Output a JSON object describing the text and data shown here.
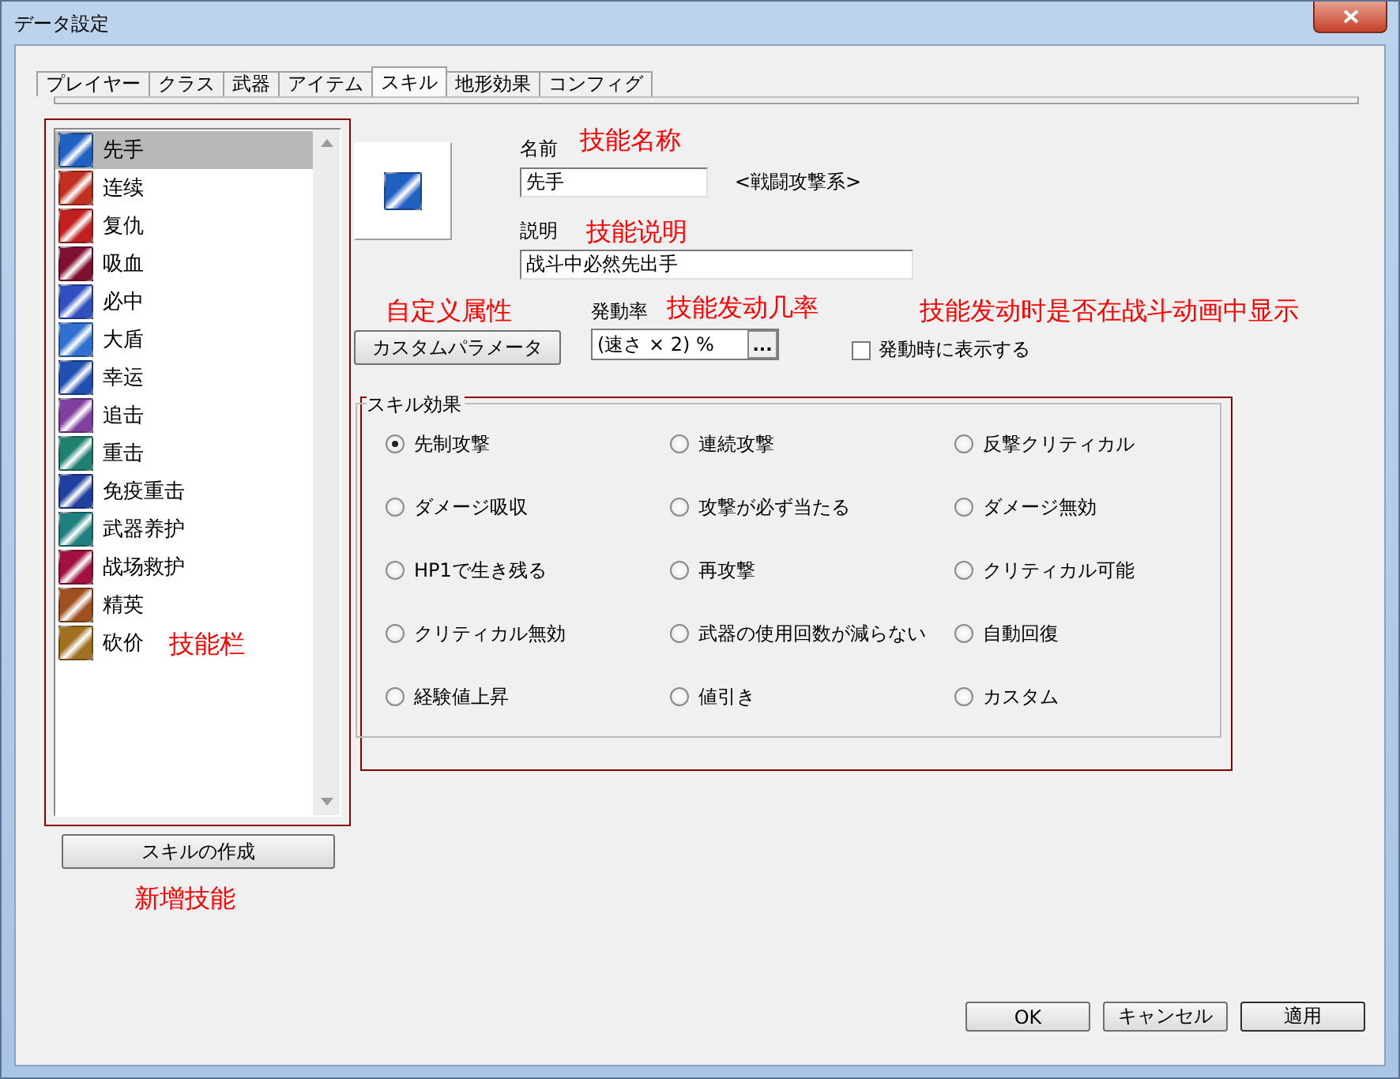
{
  "window": {
    "title": "データ設定"
  },
  "tabs": [
    {
      "label": "プレイヤー",
      "selected": false
    },
    {
      "label": "クラス",
      "selected": false
    },
    {
      "label": "武器",
      "selected": false
    },
    {
      "label": "アイテム",
      "selected": false
    },
    {
      "label": "スキル",
      "selected": true
    },
    {
      "label": "地形効果",
      "selected": false
    },
    {
      "label": "コンフィグ",
      "selected": false
    }
  ],
  "skill_list": {
    "annotation": "技能栏",
    "items": [
      {
        "label": "先手",
        "color": "#2060c0",
        "selected": true
      },
      {
        "label": "连续",
        "color": "#c03020",
        "selected": false
      },
      {
        "label": "复仇",
        "color": "#c02020",
        "selected": false
      },
      {
        "label": "吸血",
        "color": "#801030",
        "selected": false
      },
      {
        "label": "必中",
        "color": "#3050c0",
        "selected": false
      },
      {
        "label": "大盾",
        "color": "#3070d0",
        "selected": false
      },
      {
        "label": "幸运",
        "color": "#2050b0",
        "selected": false
      },
      {
        "label": "追击",
        "color": "#8040a0",
        "selected": false
      },
      {
        "label": "重击",
        "color": "#208070",
        "selected": false
      },
      {
        "label": "免疫重击",
        "color": "#2040a0",
        "selected": false
      },
      {
        "label": "武器养护",
        "color": "#208080",
        "selected": false
      },
      {
        "label": "战场救护",
        "color": "#a01040",
        "selected": false
      },
      {
        "label": "精英",
        "color": "#a05020",
        "selected": false
      },
      {
        "label": "砍价",
        "color": "#a07020",
        "selected": false
      }
    ]
  },
  "create_button": "スキルの作成",
  "create_annotation": "新增技能",
  "detail": {
    "name_label": "名前",
    "name_annotation": "技能名称",
    "name_value": "先手",
    "category": "<戦闘攻撃系>",
    "description_label": "説明",
    "description_annotation": "技能说明",
    "description_value": "战斗中必然先出手",
    "custom_button": "カスタムパラメータ",
    "custom_annotation": "自定义属性",
    "rate_label": "発動率",
    "rate_annotation": "技能发动几率",
    "rate_value": "(速さ × 2) %",
    "rate_button": "...",
    "show_checkbox": {
      "label": "発動時に表示する",
      "checked": false
    },
    "show_annotation": "技能发动时是否在战斗动画中显示"
  },
  "effects": {
    "title": "スキル効果",
    "options": [
      {
        "label": "先制攻撃",
        "selected": true
      },
      {
        "label": "連続攻撃",
        "selected": false
      },
      {
        "label": "反撃クリティカル",
        "selected": false
      },
      {
        "label": "ダメージ吸収",
        "selected": false
      },
      {
        "label": "攻撃が必ず当たる",
        "selected": false
      },
      {
        "label": "ダメージ無効",
        "selected": false
      },
      {
        "label": "HP1で生き残る",
        "selected": false
      },
      {
        "label": "再攻撃",
        "selected": false
      },
      {
        "label": "クリティカル可能",
        "selected": false
      },
      {
        "label": "クリティカル無効",
        "selected": false
      },
      {
        "label": "武器の使用回数が減らない",
        "selected": false
      },
      {
        "label": "自動回復",
        "selected": false
      },
      {
        "label": "経験値上昇",
        "selected": false
      },
      {
        "label": "値引き",
        "selected": false
      },
      {
        "label": "カスタム",
        "selected": false
      }
    ]
  },
  "buttons": [
    "OK",
    "キャンセル",
    "適用"
  ]
}
